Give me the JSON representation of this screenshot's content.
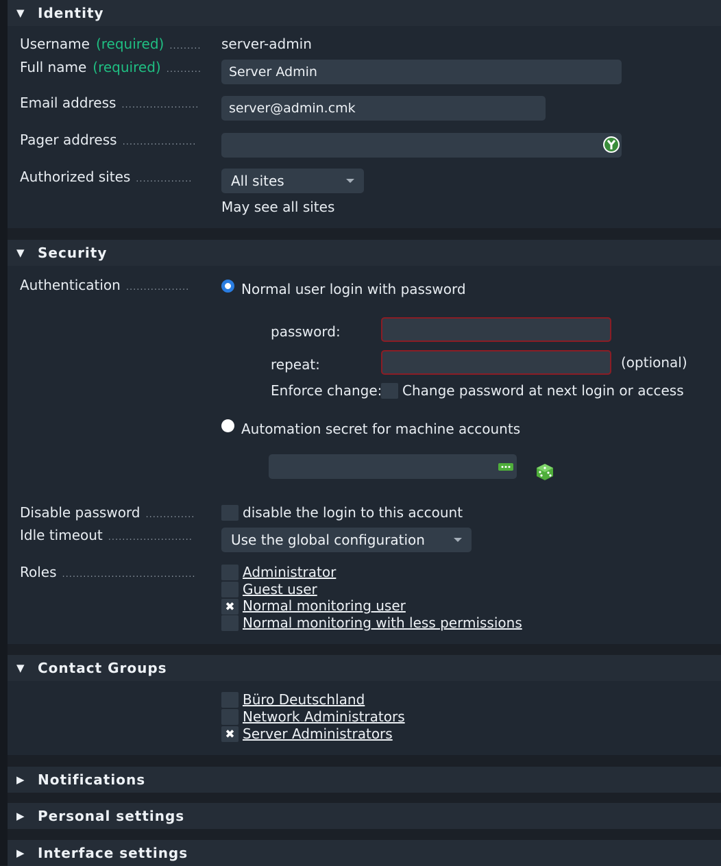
{
  "identity": {
    "title": "Identity",
    "username_label": "Username",
    "required": "(required)",
    "username_value": "server-admin",
    "fullname_label": "Full name",
    "fullname_value": "Server Admin",
    "email_label": "Email address",
    "email_value": "server@admin.cmk",
    "pager_label": "Pager address",
    "pager_value": "",
    "sites_label": "Authorized sites",
    "sites_value": "All sites",
    "sites_note": "May see all sites"
  },
  "security": {
    "title": "Security",
    "auth_label": "Authentication",
    "normal_login": "Normal user login with password",
    "password_label": "password:",
    "repeat_label": "repeat:",
    "optional": "(optional)",
    "enforce_label": "Enforce change:",
    "enforce_text": "Change password at next login or access",
    "automation_label": "Automation secret for machine accounts",
    "disable_label": "Disable password",
    "disable_text": "disable the login to this account",
    "idle_label": "Idle timeout",
    "idle_value": "Use the global configuration",
    "roles_label": "Roles",
    "roles": [
      {
        "label": "Administrator",
        "checked": false
      },
      {
        "label": "Guest user",
        "checked": false
      },
      {
        "label": "Normal monitoring user",
        "checked": true
      },
      {
        "label": "Normal monitoring with less permissions",
        "checked": false
      }
    ]
  },
  "contact_groups": {
    "title": "Contact Groups",
    "groups": [
      {
        "label": "Büro Deutschland",
        "checked": false
      },
      {
        "label": "Network Administrators",
        "checked": false
      },
      {
        "label": "Server Administrators",
        "checked": true
      }
    ]
  },
  "collapsed_sections": [
    "Notifications",
    "Personal settings",
    "Interface settings"
  ],
  "colors": {
    "background": "#1b2027",
    "header": "#252d37",
    "input": "#323d49",
    "required": "#1fbf82",
    "radio_selected": "#2a7de1",
    "error_border": "#8a1d25"
  }
}
